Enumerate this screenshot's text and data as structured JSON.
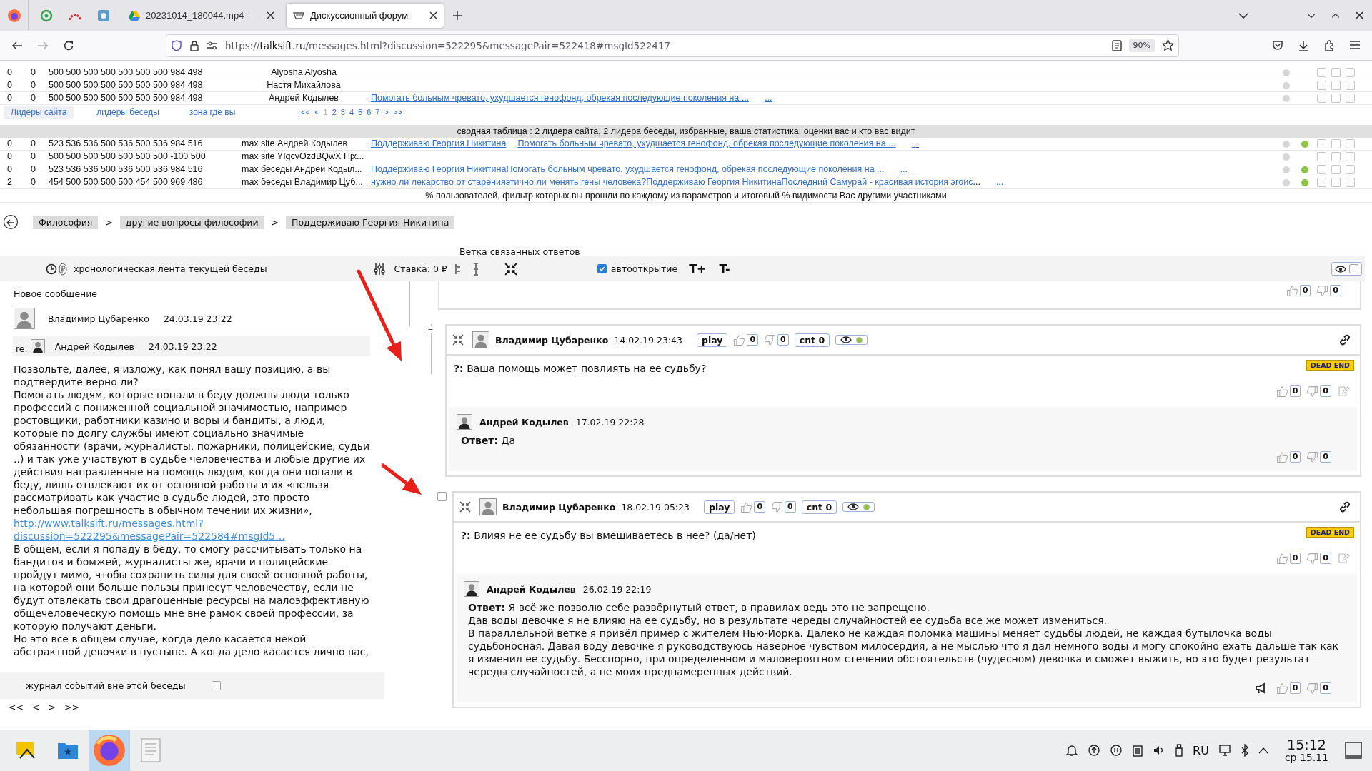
{
  "browser": {
    "tabs": [
      {
        "kind": "drive",
        "title": "20231014_180044.mp4 -",
        "selected": false
      },
      {
        "kind": "forum",
        "title": "Дискуссионный форум",
        "selected": true
      }
    ],
    "url": {
      "scheme": "https://",
      "host": "talksift.ru",
      "path": "/messages.html?discussion=522295&messagePair=522418#msgId522417"
    },
    "zoom": "90%"
  },
  "leaders": {
    "rows": [
      {
        "c1": "0",
        "c2": "0",
        "scores": "500 500 500 500 500 500 500 984 498",
        "name": "Alyosha Alyosha",
        "topics": [],
        "dots": [
          {
            "color": "#d6d6d6"
          }
        ],
        "checks": [
          false,
          false,
          false
        ]
      },
      {
        "c1": "0",
        "c2": "0",
        "scores": "500 500 500 500 500 500 500 984 498",
        "name": "Настя Михайлова",
        "topics": [],
        "dots": [
          {
            "color": "#d6d6d6"
          }
        ],
        "checks": [
          false,
          false,
          false
        ]
      },
      {
        "c1": "0",
        "c2": "0",
        "scores": "500 500 500 500 500 500 500 984 498",
        "name": "Андрей Кодылев",
        "topics": [
          {
            "kind": "link",
            "text": "Помогать больным чревато, ухудшается генофонд, обрекая последующие поколения на ..."
          },
          {
            "kind": "more",
            "text": "..."
          }
        ],
        "dots": [
          {
            "color": "#d6d6d6"
          }
        ],
        "checks": [
          false,
          false,
          false
        ]
      }
    ],
    "tabs": [
      {
        "label": "Лидеры сайта",
        "selected": true
      },
      {
        "label": "лидеры беседы",
        "selected": false
      },
      {
        "label": "зона где вы",
        "selected": false
      }
    ],
    "pager": [
      {
        "label": "<<",
        "selected": false
      },
      {
        "label": "<",
        "selected": false
      },
      {
        "label": "1",
        "selected": true
      },
      {
        "label": "2",
        "selected": false
      },
      {
        "label": "3",
        "selected": false
      },
      {
        "label": "4",
        "selected": false
      },
      {
        "label": "5",
        "selected": false
      },
      {
        "label": "6",
        "selected": false
      },
      {
        "label": "7",
        "selected": false
      },
      {
        "label": ">",
        "selected": false
      },
      {
        "label": ">>",
        "selected": false
      }
    ]
  },
  "summary": {
    "title": "сводная таблица : 2 лидера сайта, 2 лидера беседы, избранные, ваша статистика, оценки вас и кто вас видит",
    "rows": [
      {
        "c1": "0",
        "c2": "0",
        "scores": "523 536 536 500 536 500 536 984 516",
        "mode": "max site",
        "name": "Андрей Кодылев",
        "topics": [
          {
            "kind": "link",
            "text": "Поддерживаю Георгия Никитина"
          },
          {
            "kind": "link",
            "text": "Помогать больным чревато, ухудшается генофонд, обрекая последующие поколения на ..."
          },
          {
            "kind": "more",
            "text": "..."
          }
        ],
        "dots": [
          {
            "color": "#d6d6d6"
          },
          {
            "color": "#8cc63f"
          }
        ],
        "checks": [
          false,
          false,
          false
        ]
      },
      {
        "c1": "0",
        "c2": "0",
        "scores": "500 500 500 500 500 500 500 -100 500",
        "mode": "max site",
        "name": "YIgcvOzdBQwX Hjx...",
        "topics": [],
        "dots": [
          {
            "color": "#d6d6d6"
          }
        ],
        "checks": [
          false,
          false,
          false
        ]
      },
      {
        "c1": "0",
        "c2": "0",
        "scores": "523 536 536 500 536 500 536 984 516",
        "mode": "max беседы",
        "name": "Андрей Кодыл...",
        "topics": [
          {
            "kind": "link",
            "text": "Поддерживаю Георгия НикитинаПомогать больным чревато, ухудшается генофонд, обрекая последующие поколения на ..."
          },
          {
            "kind": "more",
            "text": "..."
          }
        ],
        "dots": [
          {
            "color": "#d6d6d6"
          },
          {
            "color": "#8cc63f"
          }
        ],
        "checks": [
          false,
          false,
          false
        ]
      },
      {
        "c1": "2",
        "c2": "0",
        "scores": "454 500 500 500 500 454 500 969 486",
        "mode": "max беседы",
        "name": "Владимир Цуб...",
        "topics": [
          {
            "kind": "link",
            "text": "нужно ли лекарство от старенияэтично ли менять гены человека?Поддерживаю Георгия НикитинаПоследний Самурай - красивая история эгоис"
          },
          {
            "kind": "plain",
            "text": "..."
          },
          {
            "kind": "more",
            "text": "..."
          }
        ],
        "dots": [
          {
            "color": "#d6d6d6"
          },
          {
            "color": "#8cc63f"
          }
        ],
        "checks": [
          false,
          false,
          false
        ]
      }
    ],
    "footer": "% пользователей, фильтр которых вы прошли по каждому из параметров и итоговый % видимости Вас другими участниками"
  },
  "breadcrumbs": [
    {
      "label": "Философия",
      "sep": ">"
    },
    {
      "label": "другие вопросы философии",
      "sep": ">"
    },
    {
      "label": "Поддерживаю Георгия Никитина"
    }
  ],
  "toolbar": {
    "branch_title": "Ветка связанных ответов",
    "feed_title": "хронологическая лента текущей беседы",
    "stake": "Ставка: 0 ₽",
    "autoopen": {
      "label": "автооткрытие",
      "checked": true
    },
    "font_up": "T+",
    "font_down": "T-",
    "visibility_checked": false
  },
  "feed": {
    "new_label": "Новое сообщение",
    "author": {
      "name": "Владимир Цубаренко",
      "time": "24.03.19 23:22"
    },
    "reply_to": {
      "prefix": "re:",
      "name": "Андрей Кодылев",
      "time": "24.03.19 23:22"
    },
    "body": [
      {
        "kind": "text",
        "text": "Позвольте, далее, я изложу, как понял вашу позицию, а вы подтвердите верно ли?"
      },
      {
        "kind": "text",
        "text": "Помогать людям, которые попали в беду должны люди только профессий с пониженной социальной значимостью, например ростовщики, работники казино и воры и бандиты, а люди, которые по долгу службы имеют социально значимые обязанности (врачи, журналисты, пожарники, полицейские, судьи ..) и так уже участвуют в судьбе человечества и любые другие их действия направленные на помощь людям, когда они попали в беду, лишь отвлекают их от основной работы и их «нельзя рассматривать как участие в судьбе людей, это просто небольшая погрешность в обычном течении их жизни»,"
      },
      {
        "kind": "link",
        "text": "http://www.talksift.ru/messages.html?discussion=522295&messagePair=522584#msgId5..."
      },
      {
        "kind": "text",
        "text": "В общем, если я попаду в беду, то смогу рассчитывать только на бандитов и бомжей, журналисты же, врачи и полицейские пройдут мимо, чтобы сохранить силы для своей основной работы, на которой они больше пользы принесут человечеству, если не будут отвлекать свои драгоценные ресурсы на малоэффективную общечеловеческую помощь мне вне рамок своей профессии, за которую получают деньги."
      },
      {
        "kind": "text",
        "text": "Но это все в общем случае, когда дело касается некой абстрактной девочки в пустыне. А когда дело касается лично вас,"
      }
    ],
    "events": {
      "label": "журнал событий вне этой беседы",
      "checked": false
    },
    "nav": [
      "<<",
      "<",
      ">",
      ">>"
    ]
  },
  "thread": {
    "top_votes": {
      "up": "0",
      "down": "0"
    },
    "messages": [
      {
        "gutter": {
          "kind": "collapse",
          "expanded": true
        },
        "author": "Владимир Цубаренко",
        "time": "14.02.19 23:43",
        "play": "play",
        "up": "0",
        "down": "0",
        "cnt": "cnt 0",
        "question": "**?:** Ваша помощь может повлиять на ее судьбу?",
        "badge": "DEAD END",
        "q_up": "0",
        "q_down": "0",
        "answer": {
          "author": "Андрей Кодылев",
          "time": "17.02.19 22:28",
          "paragraphs": [
            "**Ответ:** Да"
          ],
          "promoted": false,
          "up": "0",
          "down": "0"
        }
      },
      {
        "gutter": {
          "kind": "checkbox",
          "checked": false
        },
        "author": "Владимир Цубаренко",
        "time": "18.02.19 05:23",
        "play": "play",
        "up": "0",
        "down": "0",
        "cnt": "cnt 0",
        "question": "**?:** Влияя не ее судьбу вы вмешиваетесь в нее? (да/нет)",
        "badge": "DEAD END",
        "q_up": "0",
        "q_down": "0",
        "answer": {
          "author": "Андрей Кодылев",
          "time": "26.02.19 22:19",
          "paragraphs": [
            "**Ответ:** Я всё же позволю себе развёрнутый ответ, в правилах ведь это не запрещено.",
            "Дав воды девочке я не влияю на ее судьбу, но в результате череды случайностей ее судьба все же может измениться.",
            "В параллельной ветке я привёл пример с жителем Нью-Йорка. Далеко не каждая поломка машины меняет судьбы людей, не каждая бутылочка воды судьбоносная. Давая воду девочке я руководствуюсь наверное чувством милосердия, а не мыслью что я дал немного воды и могу спокойно ехать дальше так как я изменил ее судьбу. Бесспорно, при определенном и маловероятном стечении обстоятельств (чудесном) девочка и сможет выжить, но это будет результат череды случайностей, а не моих преднамеренных действий."
          ],
          "promoted": true,
          "up": "0",
          "down": "0"
        }
      }
    ]
  },
  "taskbar": {
    "apps": [
      {
        "kind": "alt",
        "selected": false
      },
      {
        "kind": "files",
        "selected": false
      },
      {
        "kind": "firefox",
        "selected": true
      },
      {
        "kind": "editor",
        "selected": false
      }
    ],
    "lang": "RU",
    "time": "15:12",
    "date": "ср 15.11"
  }
}
